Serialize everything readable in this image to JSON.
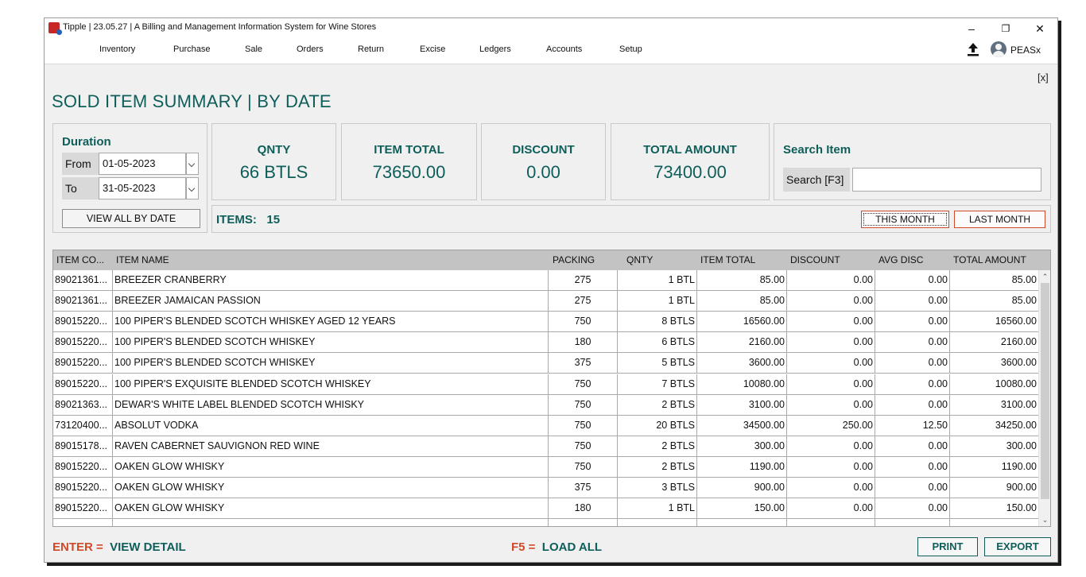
{
  "window": {
    "title": "Tipple | 23.05.27 | A Billing and Management Information System for Wine Stores"
  },
  "window_controls": {
    "minimize": "–",
    "restore": "❐",
    "close": "✕"
  },
  "menu": [
    {
      "label": "Inventory"
    },
    {
      "label": "Purchase"
    },
    {
      "label": "Sale"
    },
    {
      "label": "Orders"
    },
    {
      "label": "Return"
    },
    {
      "label": "Excise"
    },
    {
      "label": "Ledgers"
    },
    {
      "label": "Accounts"
    },
    {
      "label": "Setup"
    }
  ],
  "user": {
    "name": "PEASx",
    "icon": "user-avatar-icon",
    "upload_icon": "upload-icon"
  },
  "page": {
    "title": "SOLD ITEM SUMMARY | BY DATE",
    "close_label": "[x]"
  },
  "duration": {
    "title": "Duration",
    "from_label": "From",
    "from_value": "01-05-2023",
    "to_label": "To",
    "to_value": "31-05-2023",
    "view_all_label": "VIEW ALL BY DATE"
  },
  "stats": {
    "qnty": {
      "label": "QNTY",
      "value": "66 BTLS"
    },
    "item_total": {
      "label": "ITEM TOTAL",
      "value": "73650.00"
    },
    "discount": {
      "label": "DISCOUNT",
      "value": "0.00"
    },
    "total_amount": {
      "label": "TOTAL AMOUNT",
      "value": "73400.00"
    }
  },
  "search": {
    "title": "Search Item",
    "label": "Search [F3]",
    "value": ""
  },
  "items": {
    "label": "ITEMS:",
    "count": "15"
  },
  "range_buttons": {
    "this_month": "THIS MONTH",
    "last_month": "LAST MONTH"
  },
  "table": {
    "headers": [
      "ITEM CO...",
      "ITEM NAME",
      "PACKING",
      "QNTY",
      "ITEM TOTAL",
      "DISCOUNT",
      "AVG DISC",
      "TOTAL AMOUNT"
    ],
    "rows": [
      [
        "89021361...",
        "BREEZER CRANBERRY",
        "275",
        "1 BTL",
        "85.00",
        "0.00",
        "0.00",
        "85.00"
      ],
      [
        "89021361...",
        "BREEZER JAMAICAN PASSION",
        "275",
        "1 BTL",
        "85.00",
        "0.00",
        "0.00",
        "85.00"
      ],
      [
        "89015220...",
        "100 PIPER'S BLENDED SCOTCH WHISKEY AGED 12 YEARS",
        "750",
        "8 BTLS",
        "16560.00",
        "0.00",
        "0.00",
        "16560.00"
      ],
      [
        "89015220...",
        "100 PIPER'S BLENDED SCOTCH WHISKEY",
        "180",
        "6 BTLS",
        "2160.00",
        "0.00",
        "0.00",
        "2160.00"
      ],
      [
        "89015220...",
        "100 PIPER'S BLENDED SCOTCH WHISKEY",
        "375",
        "5 BTLS",
        "3600.00",
        "0.00",
        "0.00",
        "3600.00"
      ],
      [
        "89015220...",
        "100 PIPER'S EXQUISITE BLENDED SCOTCH WHISKEY",
        "750",
        "7 BTLS",
        "10080.00",
        "0.00",
        "0.00",
        "10080.00"
      ],
      [
        "89021363...",
        "DEWAR'S WHITE LABEL BLENDED SCOTCH WHISKY",
        "750",
        "2 BTLS",
        "3100.00",
        "0.00",
        "0.00",
        "3100.00"
      ],
      [
        "73120400...",
        "ABSOLUT VODKA",
        "750",
        "20 BTLS",
        "34500.00",
        "250.00",
        "12.50",
        "34250.00"
      ],
      [
        "89015178...",
        "RAVEN CABERNET SAUVIGNON RED WINE",
        "750",
        "2 BTLS",
        "300.00",
        "0.00",
        "0.00",
        "300.00"
      ],
      [
        "89015220...",
        "OAKEN GLOW WHISKY",
        "750",
        "2 BTLS",
        "1190.00",
        "0.00",
        "0.00",
        "1190.00"
      ],
      [
        "89015220...",
        "OAKEN GLOW WHISKY",
        "375",
        "3 BTLS",
        "900.00",
        "0.00",
        "0.00",
        "900.00"
      ],
      [
        "89015220...",
        "OAKEN GLOW WHISKY",
        "180",
        "1 BTL",
        "150.00",
        "0.00",
        "0.00",
        "150.00"
      ],
      [
        "",
        "",
        "",
        "",
        "",
        "",
        "",
        ""
      ]
    ]
  },
  "footer": {
    "enter_key": "ENTER =",
    "enter_action": "VIEW DETAIL",
    "f5_key": "F5 =",
    "f5_action": "LOAD ALL",
    "print_label": "PRINT",
    "export_label": "EXPORT"
  }
}
